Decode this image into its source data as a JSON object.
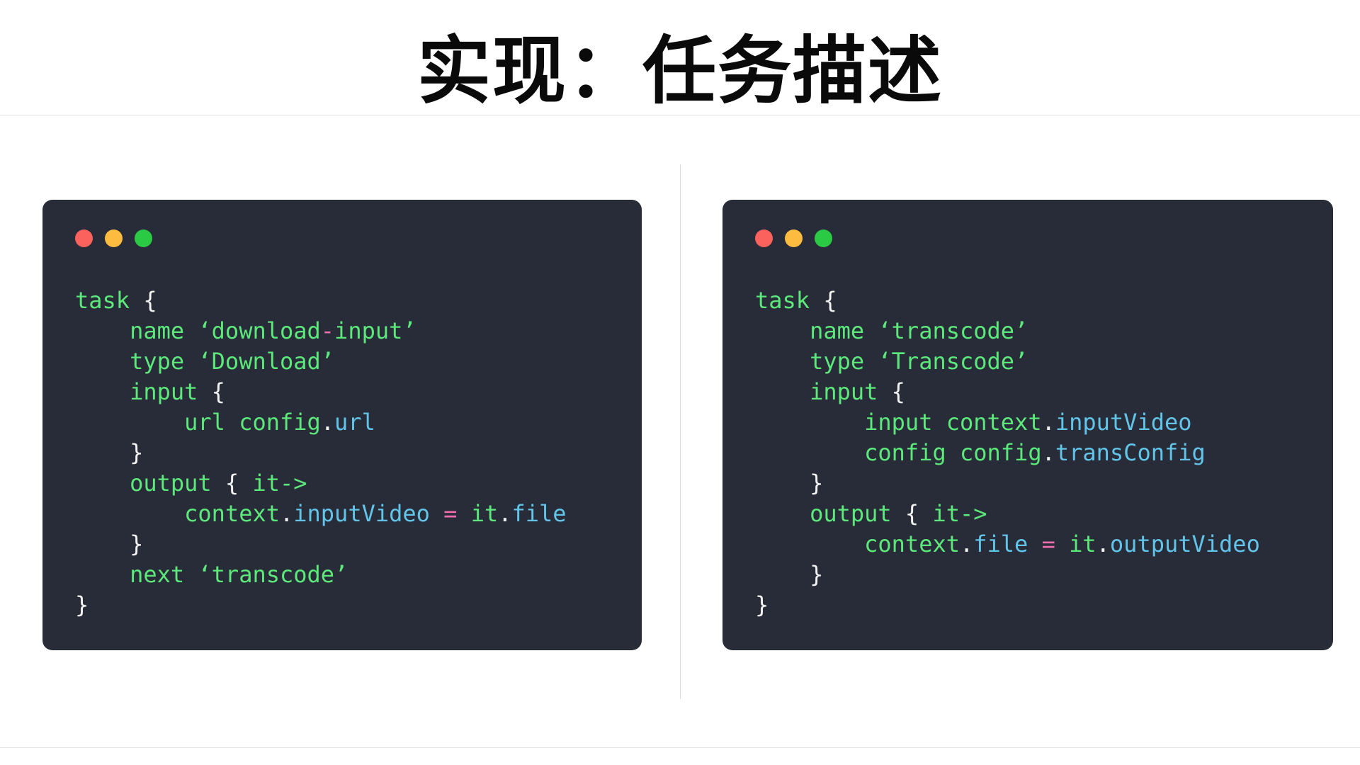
{
  "slide": {
    "title": "实现：任务描述",
    "background_color": "#ffffff",
    "divider_color": "#e3e3e6"
  },
  "theme": {
    "code_background": "#282c38",
    "keyword_color": "#5ce87a",
    "string_color": "#5ce87a",
    "punct_color": "#f2f2f2",
    "property_color": "#62c4e8",
    "operator_color": "#f06eb0",
    "dot_red": "#fc625d",
    "dot_yellow": "#fdbc40",
    "dot_green": "#2aca44"
  },
  "panels": [
    {
      "id": "download-task",
      "window_dots": [
        "close",
        "minimize",
        "maximize"
      ],
      "code_plain": "task {\n    name 'download-input'\n    type 'Download'\n    input {\n        url config.url\n    }\n    output { it->\n        context.inputVideo = it.file\n    }\n    next 'transcode'\n}",
      "lines": [
        [
          {
            "t": "task ",
            "c": "kw"
          },
          {
            "t": "{",
            "c": "punct"
          }
        ],
        [
          {
            "t": "    name ",
            "c": "kw"
          },
          {
            "t": "‘download",
            "c": "str"
          },
          {
            "t": "-",
            "c": "op"
          },
          {
            "t": "input’",
            "c": "str"
          }
        ],
        [
          {
            "t": "    type ",
            "c": "kw"
          },
          {
            "t": "‘Download’",
            "c": "str"
          }
        ],
        [
          {
            "t": "    input ",
            "c": "kw"
          },
          {
            "t": "{",
            "c": "punct"
          }
        ],
        [
          {
            "t": "        url config",
            "c": "kw"
          },
          {
            "t": ".",
            "c": "punct"
          },
          {
            "t": "url",
            "c": "prop"
          }
        ],
        [
          {
            "t": "    }",
            "c": "punct"
          }
        ],
        [
          {
            "t": "    output ",
            "c": "kw"
          },
          {
            "t": "{ ",
            "c": "punct"
          },
          {
            "t": "it->",
            "c": "kw"
          }
        ],
        [
          {
            "t": "        context",
            "c": "kw"
          },
          {
            "t": ".",
            "c": "punct"
          },
          {
            "t": "inputVideo",
            "c": "prop"
          },
          {
            "t": " = ",
            "c": "op"
          },
          {
            "t": "it",
            "c": "kw"
          },
          {
            "t": ".",
            "c": "punct"
          },
          {
            "t": "file",
            "c": "prop"
          }
        ],
        [
          {
            "t": "    }",
            "c": "punct"
          }
        ],
        [
          {
            "t": "    next ",
            "c": "kw"
          },
          {
            "t": "‘transcode’",
            "c": "str"
          }
        ],
        [
          {
            "t": "}",
            "c": "punct"
          }
        ]
      ]
    },
    {
      "id": "transcode-task",
      "window_dots": [
        "close",
        "minimize",
        "maximize"
      ],
      "code_plain": "task {\n    name 'transcode'\n    type 'Transcode'\n    input {\n        input context.inputVideo\n        config config.transConfig\n    }\n    output { it->\n        context.file = it.outputVideo\n    }\n}",
      "lines": [
        [
          {
            "t": "task ",
            "c": "kw"
          },
          {
            "t": "{",
            "c": "punct"
          }
        ],
        [
          {
            "t": "    name ",
            "c": "kw"
          },
          {
            "t": "‘transcode’",
            "c": "str"
          }
        ],
        [
          {
            "t": "    type ",
            "c": "kw"
          },
          {
            "t": "‘Transcode’",
            "c": "str"
          }
        ],
        [
          {
            "t": "    input ",
            "c": "kw"
          },
          {
            "t": "{",
            "c": "punct"
          }
        ],
        [
          {
            "t": "        input context",
            "c": "kw"
          },
          {
            "t": ".",
            "c": "punct"
          },
          {
            "t": "inputVideo",
            "c": "prop"
          }
        ],
        [
          {
            "t": "        config config",
            "c": "kw"
          },
          {
            "t": ".",
            "c": "punct"
          },
          {
            "t": "transConfig",
            "c": "prop"
          }
        ],
        [
          {
            "t": "    }",
            "c": "punct"
          }
        ],
        [
          {
            "t": "    output ",
            "c": "kw"
          },
          {
            "t": "{ ",
            "c": "punct"
          },
          {
            "t": "it->",
            "c": "kw"
          }
        ],
        [
          {
            "t": "        context",
            "c": "kw"
          },
          {
            "t": ".",
            "c": "punct"
          },
          {
            "t": "file",
            "c": "prop"
          },
          {
            "t": " = ",
            "c": "op"
          },
          {
            "t": "it",
            "c": "kw"
          },
          {
            "t": ".",
            "c": "punct"
          },
          {
            "t": "outputVideo",
            "c": "prop"
          }
        ],
        [
          {
            "t": "    }",
            "c": "punct"
          }
        ],
        [
          {
            "t": "}",
            "c": "punct"
          }
        ]
      ]
    }
  ]
}
